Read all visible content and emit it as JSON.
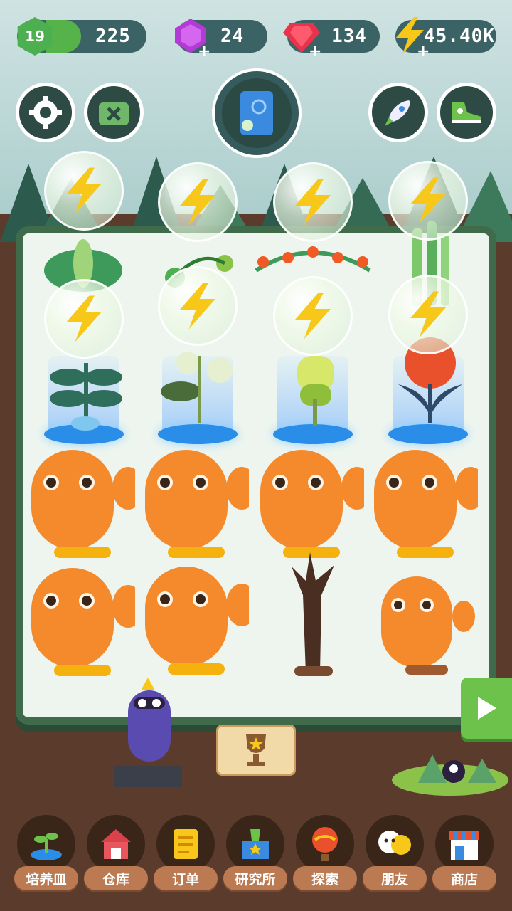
{
  "hud": {
    "level": "19",
    "xp": "225",
    "xp_progress": 0.35,
    "gems": "24",
    "rubies": "134",
    "energy": "45.40K"
  },
  "colors": {
    "board_border": "#3f6b4a",
    "cactus": "#f58a2c",
    "nav_label": "#bc7a52",
    "play": "#6cc24a"
  },
  "top_buttons": [
    {
      "name": "settings-button",
      "icon": "gear-icon"
    },
    {
      "name": "ads-off-button",
      "icon": "tv-cross-icon"
    },
    {
      "name": "guidebook-button",
      "icon": "book-icon"
    },
    {
      "name": "rocket-button",
      "icon": "rocket-icon"
    },
    {
      "name": "boost-button",
      "icon": "sneaker-icon"
    }
  ],
  "nav": [
    {
      "label": "培养皿",
      "icon": "sprout-icon"
    },
    {
      "label": "仓库",
      "icon": "barn-icon"
    },
    {
      "label": "订单",
      "icon": "scroll-icon"
    },
    {
      "label": "研究所",
      "icon": "lab-icon"
    },
    {
      "label": "探索",
      "icon": "balloon-icon"
    },
    {
      "label": "朋友",
      "icon": "friends-icon"
    },
    {
      "label": "商店",
      "icon": "shop-icon"
    }
  ]
}
